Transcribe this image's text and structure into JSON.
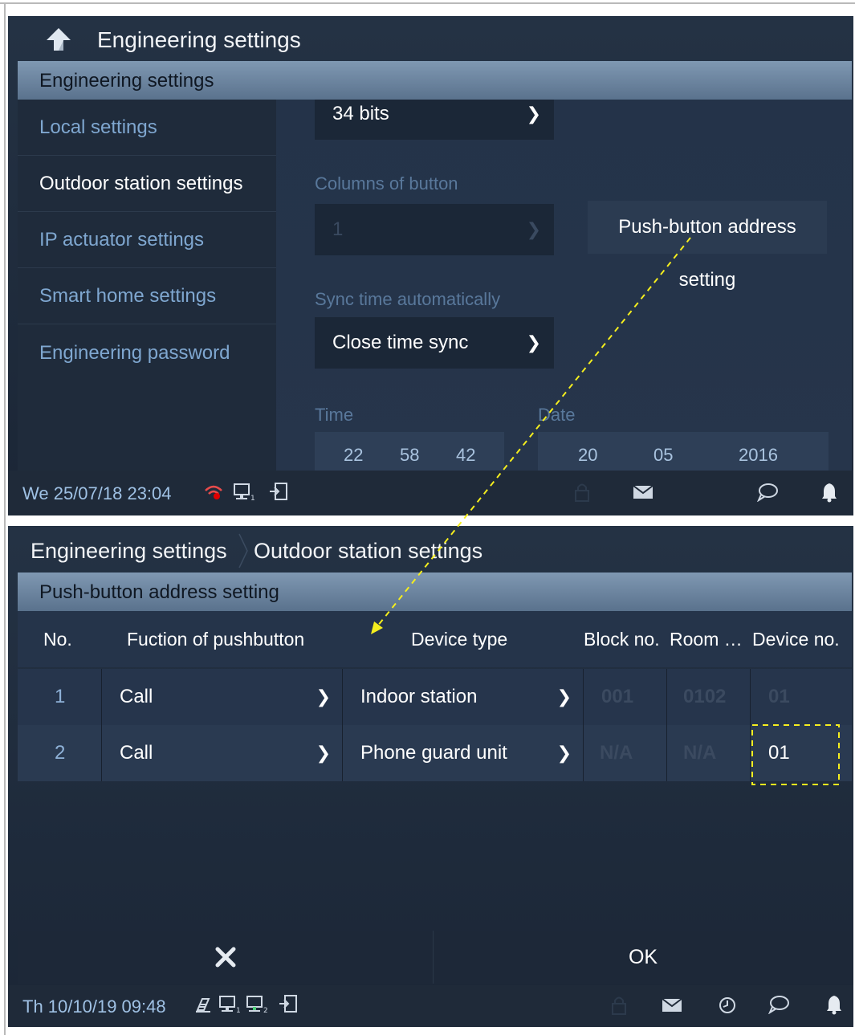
{
  "screen1": {
    "title": "Engineering settings",
    "section_title": "Engineering settings",
    "sidebar": [
      {
        "label": "Local settings"
      },
      {
        "label": "Outdoor station settings"
      },
      {
        "label": "IP actuator settings"
      },
      {
        "label": "Smart home settings"
      },
      {
        "label": "Engineering password"
      }
    ],
    "bits_value": "34 bits",
    "columns_label": "Columns of button",
    "columns_value": "1",
    "push_button_label": "Push-button address setting",
    "sync_label": "Sync time automatically",
    "sync_value": "Close time sync",
    "time_label": "Time",
    "date_label": "Date",
    "time": [
      "22",
      "58",
      "42"
    ],
    "date": [
      "20",
      "05",
      "2016"
    ],
    "status_datetime": "We 25/07/18  23:04"
  },
  "screen2": {
    "crumb_root": "Engineering settings",
    "crumb_current": "Outdoor station settings",
    "section_title": "Push-button address setting",
    "columns": {
      "no": "No.",
      "function": "Fuction of pushbutton",
      "device_type": "Device type",
      "block": "Block no.",
      "room": "Room …",
      "device_no": "Device no."
    },
    "rows": [
      {
        "no": "1",
        "function": "Call",
        "device_type": "Indoor station",
        "block": "001",
        "room": "0102",
        "device_no": "01"
      },
      {
        "no": "2",
        "function": "Call",
        "device_type": "Phone guard unit",
        "block": "N/A",
        "room": "N/A",
        "device_no": "01"
      }
    ],
    "ok_label": "OK",
    "status_datetime": "Th 10/10/19  09:48"
  },
  "colors": {
    "highlight": "#f5ee1e",
    "link_text": "#7fa7d0",
    "section_bar": "#6f88a3"
  }
}
